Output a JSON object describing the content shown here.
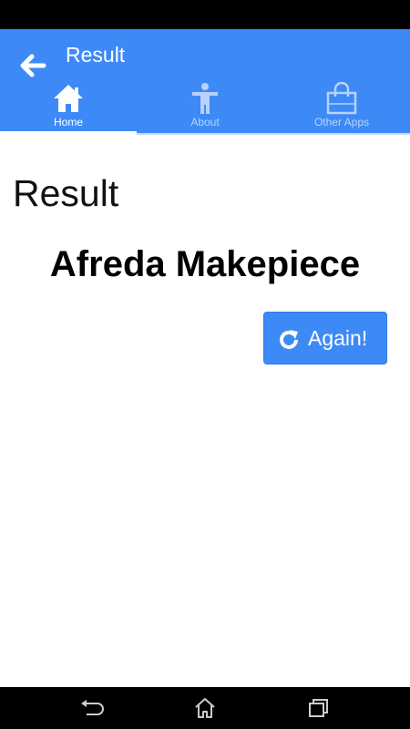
{
  "app_bar": {
    "title": "Result",
    "back_icon": "arrow-left-icon",
    "background": "#3d8af7"
  },
  "tabs": [
    {
      "label": "Home",
      "icon": "home-icon",
      "active": true
    },
    {
      "label": "About",
      "icon": "person-icon",
      "active": false
    },
    {
      "label": "Other Apps",
      "icon": "shopping-bag-icon",
      "active": false
    }
  ],
  "main": {
    "heading": "Result",
    "name": "Afreda Makepiece",
    "again_button": {
      "label": "Again!",
      "icon": "refresh-icon"
    }
  },
  "nav_bar": {
    "icons": [
      "back-nav-icon",
      "home-nav-icon",
      "recents-nav-icon"
    ]
  }
}
